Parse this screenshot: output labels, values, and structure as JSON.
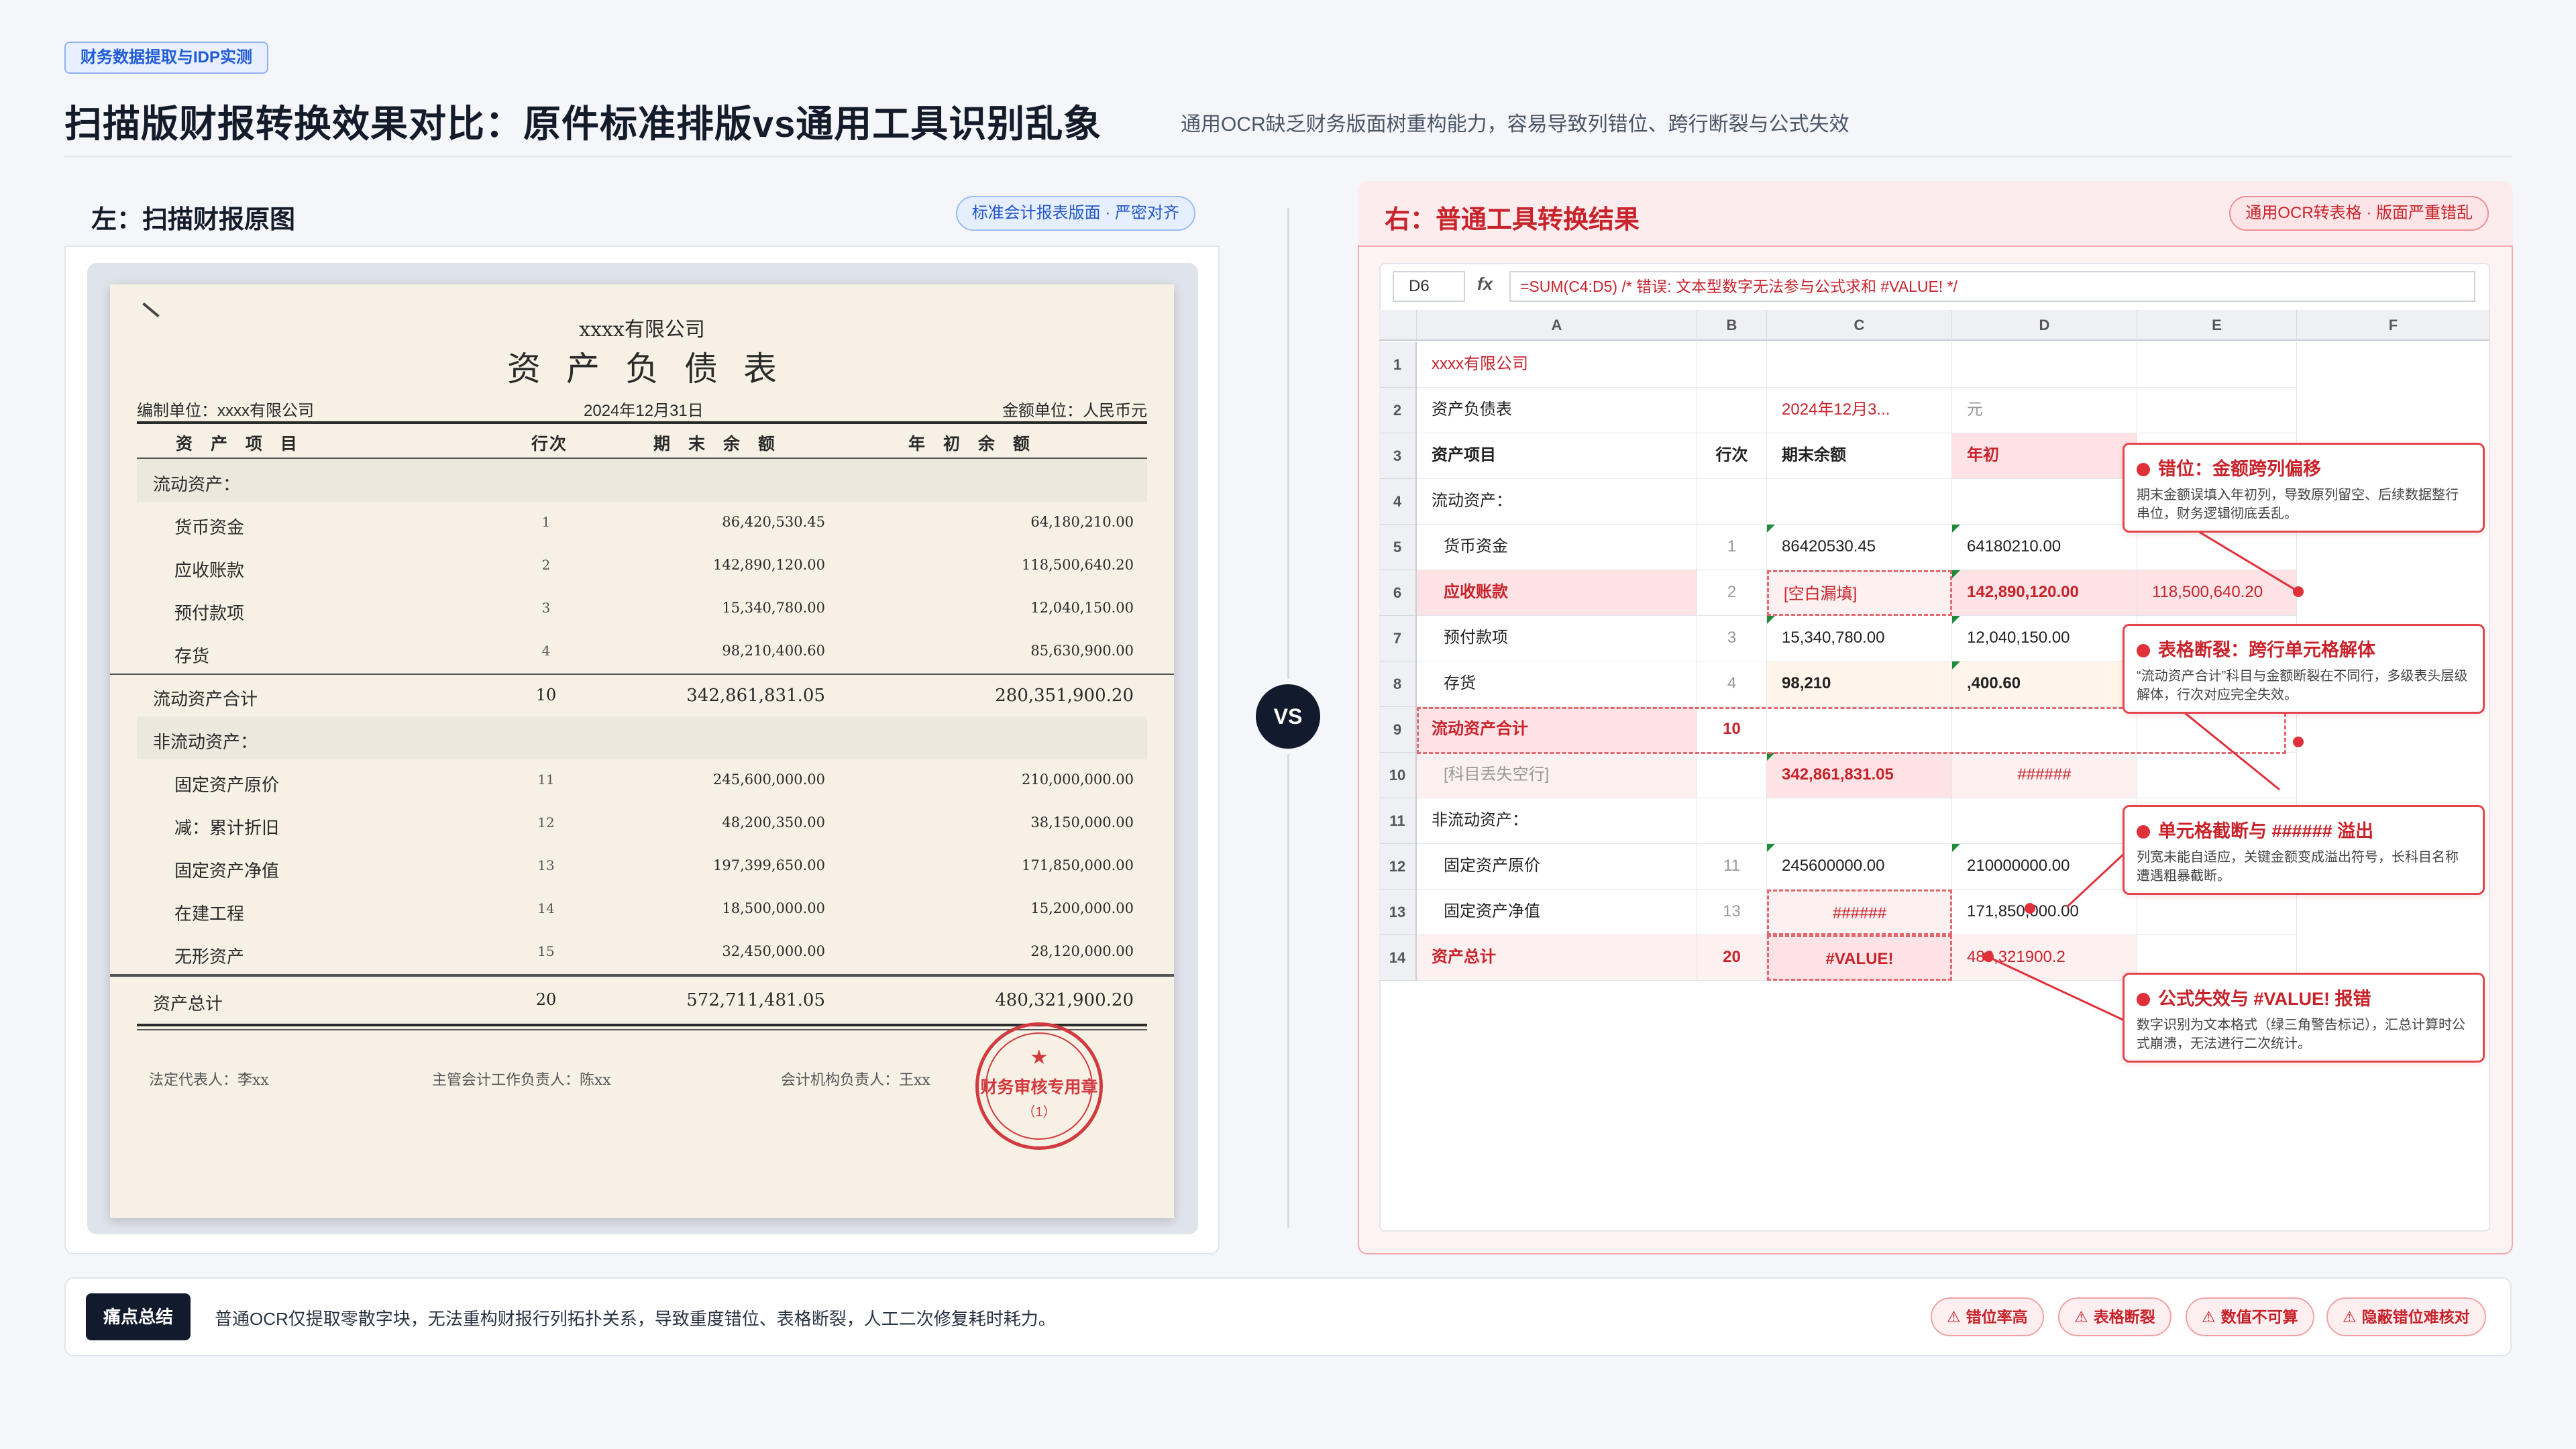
{
  "header": {
    "tag": "财务数据提取与IDP实测",
    "title": "扫描版财报转换效果对比：原件标准排版vs通用工具识别乱象",
    "subtitle": "通用OCR缺乏财务版面树重构能力，容易导致列错位、跨行断裂与公式失效"
  },
  "left_panel": {
    "title": "左：扫描财报原图",
    "badge": "标准会计报表版面 · 严密对齐",
    "doc": {
      "company": "xxxx有限公司",
      "title": "资产负债表",
      "unit": "编制单位：xxxx有限公司",
      "date": "2024年12月31日",
      "currency": "金额单位：人民币元",
      "headers": {
        "item": "资 产 项 目",
        "no": "行次",
        "end": "期 末 余 额",
        "begin": "年 初 余 额"
      },
      "rows": [
        {
          "item": "流动资产：",
          "no": "",
          "end": "",
          "begin": ""
        },
        {
          "item": "货币资金",
          "no": "1",
          "end": "86,420,530.45",
          "begin": "64,180,210.00"
        },
        {
          "item": "应收账款",
          "no": "2",
          "end": "142,890,120.00",
          "begin": "118,500,640.20"
        },
        {
          "item": "预付款项",
          "no": "3",
          "end": "15,340,780.00",
          "begin": "12,040,150.00"
        },
        {
          "item": "存货",
          "no": "4",
          "end": "98,210,400.60",
          "begin": "85,630,900.00"
        },
        {
          "item": "流动资产合计",
          "no": "10",
          "end": "342,861,831.05",
          "begin": "280,351,900.20"
        },
        {
          "item": "非流动资产：",
          "no": "",
          "end": "",
          "begin": ""
        },
        {
          "item": "固定资产原价",
          "no": "11",
          "end": "245,600,000.00",
          "begin": "210,000,000.00"
        },
        {
          "item": "减：累计折旧",
          "no": "12",
          "end": "48,200,350.00",
          "begin": "38,150,000.00"
        },
        {
          "item": "固定资产净值",
          "no": "13",
          "end": "197,399,650.00",
          "begin": "171,850,000.00"
        },
        {
          "item": "在建工程",
          "no": "14",
          "end": "18,500,000.00",
          "begin": "15,200,000.00"
        },
        {
          "item": "无形资产",
          "no": "15",
          "end": "32,450,000.00",
          "begin": "28,120,000.00"
        },
        {
          "item": "资产总计",
          "no": "20",
          "end": "572,711,481.05",
          "begin": "480,321,900.20"
        }
      ],
      "signatures": {
        "legal": "法定代表人：李xx",
        "accounting": "主管会计工作负责人：陈xx",
        "head": "会计机构负责人：王xx"
      },
      "stamp": {
        "star": "★",
        "text": "财务审核专用章",
        "num": "（1）"
      }
    }
  },
  "vs": "VS",
  "right_panel": {
    "title": "右：普通工具转换结果",
    "badge": "通用OCR转表格 · 版面严重错乱",
    "formula_bar": {
      "cell_ref": "D6",
      "fx": "fx",
      "formula": "=SUM(C4:D5)  /* 错误: 文本型数字无法参与公式求和 #VALUE! */"
    },
    "columns": [
      "A",
      "B",
      "C",
      "D",
      "E",
      "F"
    ],
    "rows": [
      {
        "n": "1",
        "a": "xxxx有限公司",
        "b": "",
        "c": "",
        "d": "",
        "e": ""
      },
      {
        "n": "2",
        "a": "资产负债表",
        "b": "",
        "c": "2024年12月3...",
        "d": "元",
        "e": ""
      },
      {
        "n": "3",
        "a": "资产项目",
        "b": "行次",
        "c": "期末余额",
        "d": "年初",
        "e": ""
      },
      {
        "n": "4",
        "a": "流动资产：",
        "b": "",
        "c": "",
        "d": "",
        "e": ""
      },
      {
        "n": "5",
        "a": "货币资金",
        "b": "1",
        "c": "86420530.45",
        "d": "64180210.00",
        "e": ""
      },
      {
        "n": "6",
        "a": "应收账款",
        "b": "2",
        "c": "[空白漏填]",
        "d": "142,890,120.00",
        "e": "118,500,640.20"
      },
      {
        "n": "7",
        "a": "预付款项",
        "b": "3",
        "c": "15,340,780.00",
        "d": "12,040,150.00",
        "e": ""
      },
      {
        "n": "8",
        "a": "存货",
        "b": "4",
        "c": "98,210",
        "d": ",400.60",
        "e": ""
      },
      {
        "n": "9",
        "a": "流动资产合计",
        "b": "10",
        "c": "",
        "d": "",
        "e": ""
      },
      {
        "n": "10",
        "a": "[科目丢失空行]",
        "b": "",
        "c": "342,861,831.05",
        "d": "######",
        "e": ""
      },
      {
        "n": "11",
        "a": "非流动资产：",
        "b": "",
        "c": "",
        "d": "",
        "e": ""
      },
      {
        "n": "12",
        "a": "固定资产原价",
        "b": "11",
        "c": "245600000.00",
        "d": "210000000.00",
        "e": ""
      },
      {
        "n": "13",
        "a": "固定资产净值",
        "b": "13",
        "c": "######",
        "d": "171,850,000.00",
        "e": ""
      },
      {
        "n": "14",
        "a": "资产总计",
        "b": "20",
        "c": "#VALUE!",
        "d": "480,321900.2",
        "e": ""
      }
    ],
    "callouts": [
      {
        "title": "错位：金额跨列偏移",
        "body": "期末金额误填入年初列，导致原列留空、后续数据整行串位，财务逻辑彻底丢乱。"
      },
      {
        "title": "表格断裂：跨行单元格解体",
        "body": "“流动资产合计”科目与金额断裂在不同行，多级表头层级解体，行次对应完全失效。"
      },
      {
        "title": "单元格截断与 ###### 溢出",
        "body": "列宽未能自适应，关键金额变成溢出符号，长科目名称遭遇粗暴截断。"
      },
      {
        "title": "公式失效与 #VALUE! 报错",
        "body": "数字识别为文本格式（绿三角警告标记），汇总计算时公式崩溃，无法进行二次统计。"
      }
    ]
  },
  "footer": {
    "label": "痛点总结",
    "text": "普通OCR仅提取零散字块，无法重构财报行列拓扑关系，导致重度错位、表格断裂，人工二次修复耗时耗力。",
    "tags": [
      "错位率高",
      "表格断裂",
      "数值不可算",
      "隐蔽错位难核对"
    ]
  },
  "colors": {
    "accent_blue": "#1f5bd6",
    "alert_red": "#c8232b",
    "dark_navy": "#111b2d"
  }
}
